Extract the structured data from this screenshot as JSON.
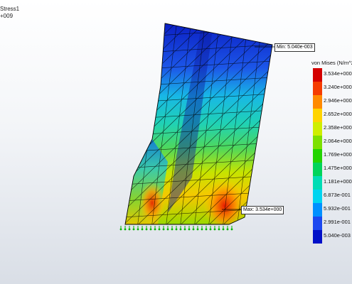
{
  "header": {
    "study_line": "Stress1",
    "scale_line": "+009"
  },
  "legend": {
    "title": "von Mises (N/m^2",
    "entries": [
      {
        "label": "3.534e+000",
        "color": "#d40000"
      },
      {
        "label": "3.240e+000",
        "color": "#f53c00"
      },
      {
        "label": "2.946e+000",
        "color": "#ff8a00"
      },
      {
        "label": "2.652e+000",
        "color": "#ffd400"
      },
      {
        "label": "2.358e+000",
        "color": "#cfee00"
      },
      {
        "label": "2.064e+000",
        "color": "#7de000"
      },
      {
        "label": "1.769e+000",
        "color": "#23d400"
      },
      {
        "label": "1.475e+000",
        "color": "#00d45a"
      },
      {
        "label": "1.181e+000",
        "color": "#00dcb4"
      },
      {
        "label": "6.873e-001",
        "color": "#00d4f0"
      },
      {
        "label": "5.932e-001",
        "color": "#0090ff"
      },
      {
        "label": "2.991e-001",
        "color": "#1c48f0"
      },
      {
        "label": "5.040e-003",
        "color": "#0010c8"
      }
    ]
  },
  "callouts": {
    "min": "Min: 5.040e-003",
    "max": "Max: 3.534e+000"
  },
  "colors": {
    "background_top": "#ffffff",
    "background_bottom": "#d9dee6",
    "mesh_line": "#000000",
    "fixture_marker": "#00b400"
  }
}
